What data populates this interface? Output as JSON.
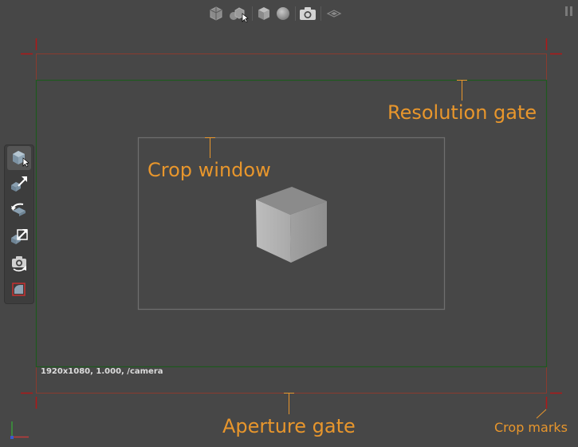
{
  "toolbar": {
    "icons": [
      "wireframe-cube-icon",
      "multi-object-select-icon",
      "shaded-cube-icon",
      "sphere-icon",
      "camera-icon",
      "ground-plane-icon"
    ],
    "pause_icon": "pause-icon"
  },
  "side_toolbar": {
    "tools": [
      "select-tool-icon",
      "move-tool-icon",
      "rotate-tool-icon",
      "scale-tool-icon",
      "camera-orbit-icon",
      "crop-tool-icon"
    ]
  },
  "viewport": {
    "info_text": "1920x1080, 1.000, /camera",
    "labels": {
      "resolution_gate": "Resolution gate",
      "crop_window": "Crop window",
      "aperture_gate": "Aperture gate",
      "crop_marks": "Crop marks"
    },
    "colors": {
      "label": "#e8962c",
      "resolution_gate": "#1e5a1e",
      "aperture_gate": "#8a3a2e",
      "crop_marks": "#b01818",
      "crop_window": "#6e6e6e"
    },
    "axis_icon": "axis-gizmo-icon"
  }
}
